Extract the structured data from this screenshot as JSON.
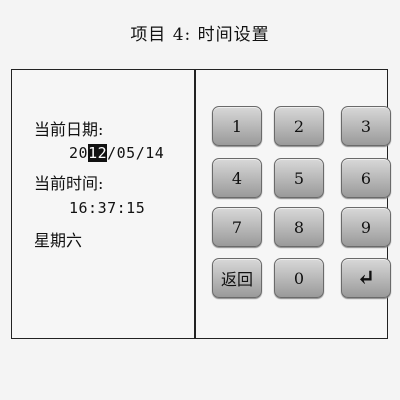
{
  "header": {
    "title": "项目 4: 时间设置"
  },
  "info": {
    "date_label": "当前日期:",
    "date_value_before": "20",
    "date_value_cursor": "12",
    "date_value_after": "/05/14",
    "time_label": "当前时间:",
    "time_value": "16:37:15",
    "weekday": "星期六"
  },
  "keypad": {
    "k1": "1",
    "k2": "2",
    "k3": "3",
    "k4": "4",
    "k5": "5",
    "k6": "6",
    "k7": "7",
    "k8": "8",
    "k9": "9",
    "back": "返回",
    "k0": "0",
    "enter": "↵"
  }
}
